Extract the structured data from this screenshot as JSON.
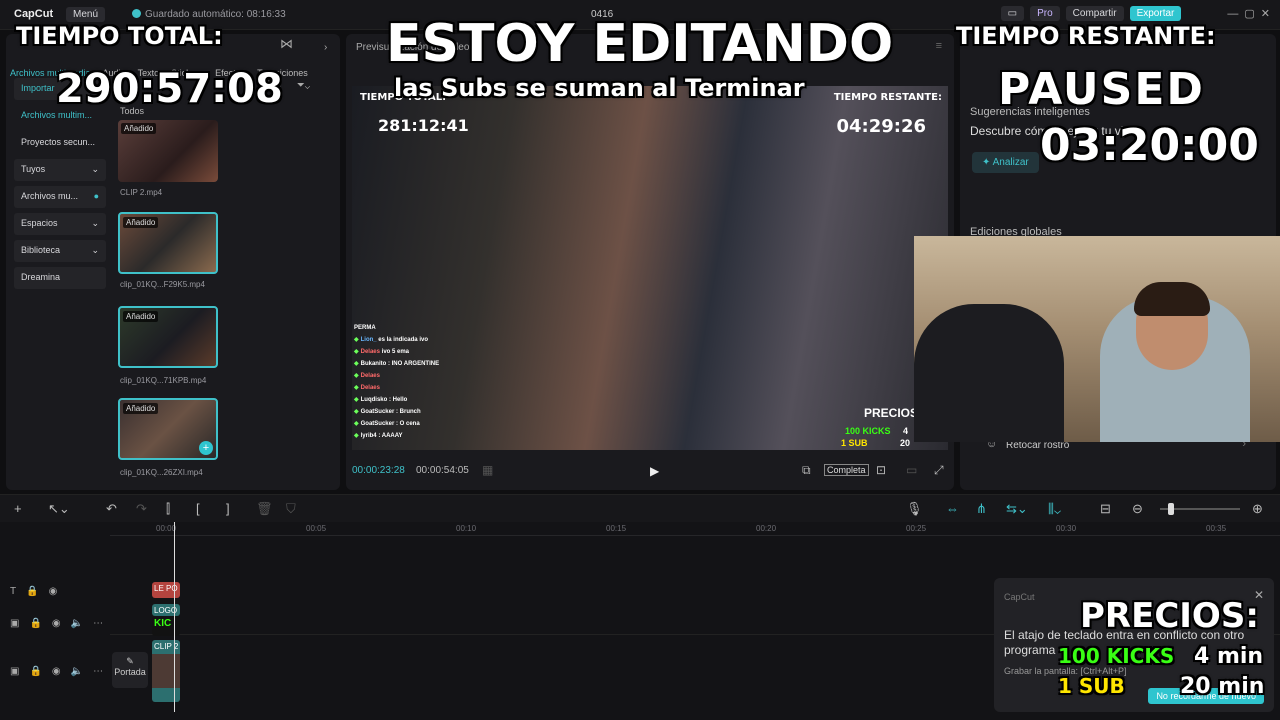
{
  "topbar": {
    "app": "CapCut",
    "menu": "Menú",
    "autosave": "Guardado automático: 08:16:33",
    "project": "0416",
    "pro": "Pro",
    "share": "Compartir",
    "export": "Exportar"
  },
  "left": {
    "tabs": [
      "Archivos multimedia",
      "Audio",
      "Texto",
      "Stickers",
      "Efectos",
      "Transiciones"
    ],
    "nav": [
      "Importar",
      "Archivos multim...",
      "Proyectos secun...",
      "Tuyos",
      "Archivos mu...",
      "Espacios",
      "Biblioteca",
      "Dreamina"
    ],
    "all": "Todos",
    "added": "Añadido",
    "clips": [
      "CLIP 2.mp4",
      "clip_01KQ...F29K5.mp4",
      "clip_01KQ...71KPB.mp4",
      "clip_01KQ...26ZXI.mp4"
    ]
  },
  "player": {
    "title": "Previsualización de vídeo",
    "video_total_label": "TIEMPO TOTAL:",
    "video_total_val": "281:12:41",
    "video_rest_label": "TIEMPO RESTANTE:",
    "video_rest_val": "04:29:26",
    "chat": [
      [
        "PERMA",
        ""
      ],
      [
        "Lion_",
        "es la indicada ivo"
      ],
      [
        "Delaes",
        "ivo 5 ema"
      ],
      [
        "Bukanito",
        ": INO ARGENTINE"
      ],
      [
        "Delaes",
        ""
      ],
      [
        "Delaes",
        ""
      ],
      [
        "Luqdisko",
        ": Hello"
      ],
      [
        "GoatSucker",
        ": Brunch"
      ],
      [
        "GoatSucker",
        ": O cena"
      ],
      [
        "lyrib4",
        ": AAAAY"
      ]
    ],
    "video_precios": "PRECIOS",
    "video_kicks": "100 KICKS",
    "video_sub": "1 SUB",
    "video_kicks_val": "4",
    "video_sub_val": "20",
    "current": "00:00:23:28",
    "total": "00:00:54:05",
    "complete": "Completa"
  },
  "right": {
    "suggestions": "Sugerencias inteligentes",
    "discover": "Descubre cómo mejorar tu video",
    "analyze": "Analizar",
    "global": "Ediciones globales",
    "retouch": "Retocar rostro"
  },
  "timeline": {
    "ruler": [
      "00:00",
      "00:05",
      "00:10",
      "00:15",
      "00:20",
      "00:25",
      "00:30",
      "00:35"
    ],
    "cover": "Portada",
    "clip_labels": [
      "LE PO",
      "LOGO",
      "KIC",
      "CLIP 2"
    ]
  },
  "dialog": {
    "brand": "CapCut",
    "text": "El atajo de teclado entra en conflicto con otro programa",
    "hint": "Grabar la pantalla: [Ctrl+Alt+P]",
    "btn": "No recordarme de nuevo"
  },
  "overlay": {
    "total_label": "TIEMPO TOTAL:",
    "total_value": "290:57:08",
    "heading": "ESTOY EDITANDO",
    "subs_note": "las Subs se suman al Terminar",
    "rest_label": "TIEMPO RESTANTE:",
    "paused": "PAUSED",
    "rest_value": "03:20:00",
    "precios": "PRECIOS:",
    "kicks": "100 KICKS",
    "sub": "1 SUB",
    "kicks_price": "4 min",
    "sub_price": "20 min"
  }
}
